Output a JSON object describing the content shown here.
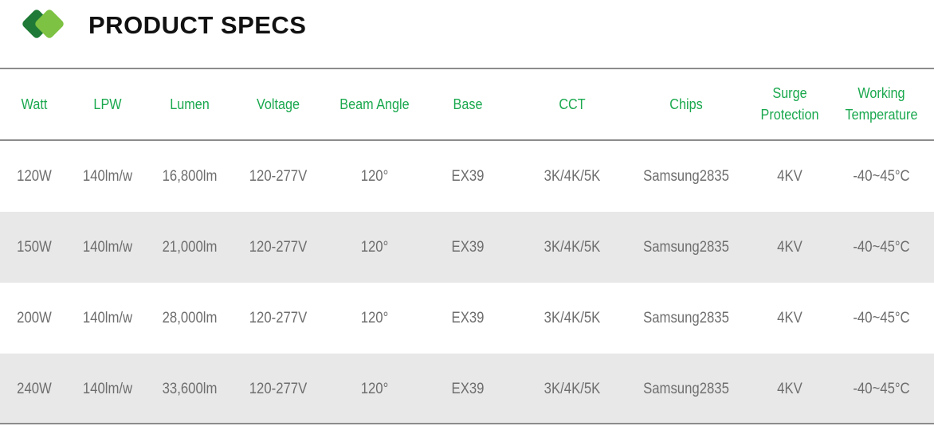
{
  "header": {
    "title": "PRODUCT SPECS",
    "logo_icon": "green-diamond-logo-icon",
    "logo_colors": [
      "#1e7a36",
      "#7dc242"
    ]
  },
  "colors": {
    "header_text": "#1aa84e",
    "cell_text": "#6e6e6e",
    "row_shade": "#e8e8e8",
    "rule": "#8c8c8c"
  },
  "table": {
    "columns": [
      "Watt",
      "LPW",
      "Lumen",
      "Voltage",
      "Beam Angle",
      "Base",
      "CCT",
      "Chips",
      "Surge\nProtection",
      "Working\nTemperature"
    ],
    "rows": [
      [
        "120W",
        "140lm/w",
        "16,800lm",
        "120-277V",
        "120°",
        "EX39",
        "3K/4K/5K",
        "Samsung2835",
        "4KV",
        "-40~45°C"
      ],
      [
        "150W",
        "140lm/w",
        "21,000lm",
        "120-277V",
        "120°",
        "EX39",
        "3K/4K/5K",
        "Samsung2835",
        "4KV",
        "-40~45°C"
      ],
      [
        "200W",
        "140lm/w",
        "28,000lm",
        "120-277V",
        "120°",
        "EX39",
        "3K/4K/5K",
        "Samsung2835",
        "4KV",
        "-40~45°C"
      ],
      [
        "240W",
        "140lm/w",
        "33,600lm",
        "120-277V",
        "120°",
        "EX39",
        "3K/4K/5K",
        "Samsung2835",
        "4KV",
        "-40~45°C"
      ]
    ]
  }
}
